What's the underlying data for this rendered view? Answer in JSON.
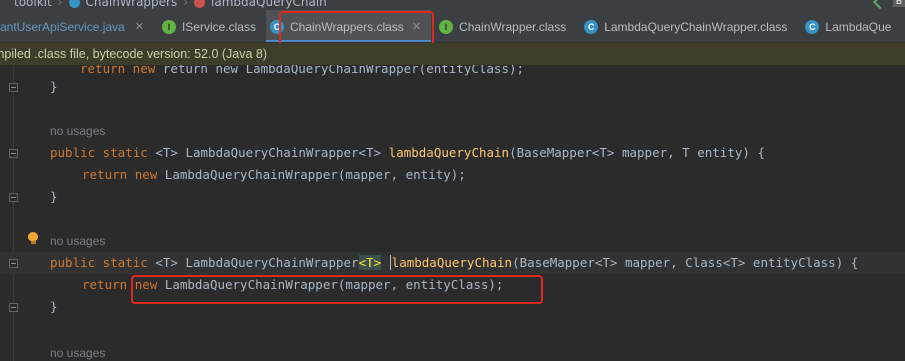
{
  "breadcrumb": {
    "items": [
      "toolkit",
      "ChainWrappers",
      "lambdaQueryChain"
    ]
  },
  "tabs": [
    {
      "label": "antUserApiService.java",
      "icon": "java-file-icon",
      "icon_glyph": ""
    },
    {
      "label": "IService.class",
      "icon": "interface-icon",
      "icon_glyph": "I"
    },
    {
      "label": "ChainWrappers.class",
      "icon": "class-icon",
      "icon_glyph": "C",
      "active": true
    },
    {
      "label": "ChainWrapper.class",
      "icon": "interface-icon",
      "icon_glyph": "I"
    },
    {
      "label": "LambdaQueryChainWrapper.class",
      "icon": "class-icon",
      "icon_glyph": "C"
    },
    {
      "label": "LambdaQue",
      "icon": "class-icon",
      "icon_glyph": "C"
    }
  ],
  "banner": {
    "text": "mpiled .class file, bytecode version: 52.0 (Java 8)"
  },
  "code": {
    "line0": "return new LambdaQueryChainWrapper(entityClass);",
    "brace": "}",
    "usage_hint": "no usages",
    "m1": {
      "mod": "public static ",
      "generic": "<T> ",
      "ret": "LambdaQueryChainWrapper<T> ",
      "name": "lambdaQueryChain",
      "params": "(BaseMapper<T> mapper, T entity) {",
      "ret_kw": "return ",
      "new_kw": "new ",
      "body": "LambdaQueryChainWrapper(mapper, entity);"
    },
    "m2": {
      "mod": "public static ",
      "generic": "<T> ",
      "ret_a": "LambdaQueryChainWrapper",
      "ret_hl": "<T>",
      "name": "lambdaQueryChain",
      "params": "(BaseMapper<T> mapper, Class<T> entityClass) {",
      "ret_kw": "return ",
      "new_kw": "new ",
      "body": "LambdaQueryChainWrapper(mapper, entityClass);"
    }
  },
  "colors": {
    "keyword": "#cc7832",
    "method": "#ffc66d",
    "text": "#a9b7c6",
    "annotation_box": "#e0281e"
  }
}
